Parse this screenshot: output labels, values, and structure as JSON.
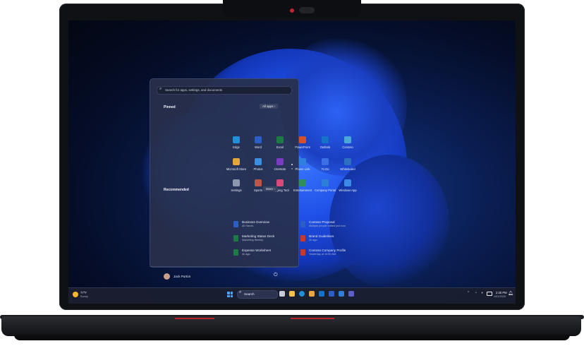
{
  "start_menu": {
    "search_placeholder": "Search for apps, settings, and documents",
    "pinned_label": "Pinned",
    "all_apps_label": "All apps",
    "pinned_apps": [
      {
        "label": "Edge",
        "icon": "edge-icon",
        "color": "#1f8fd8"
      },
      {
        "label": "Word",
        "icon": "word-icon",
        "color": "#2b5fc7"
      },
      {
        "label": "Excel",
        "icon": "excel-icon",
        "color": "#1d7a45"
      },
      {
        "label": "PowerPoint",
        "icon": "powerpoint-icon",
        "color": "#d2502a"
      },
      {
        "label": "Outlook",
        "icon": "outlook-icon",
        "color": "#1473c9"
      },
      {
        "label": "Contoso",
        "icon": "contoso-icon",
        "color": "#4aa7d9"
      },
      {
        "label": "Microsoft Store",
        "icon": "store-icon",
        "color": "#e8a53b"
      },
      {
        "label": "Photos",
        "icon": "photos-icon",
        "color": "#3a8fe0"
      },
      {
        "label": "OneNote",
        "icon": "onenote-icon",
        "color": "#7b3bbf"
      },
      {
        "label": "Phone Link",
        "icon": "phone-link-icon",
        "color": "#2f7fe0"
      },
      {
        "label": "To Do",
        "icon": "todo-icon",
        "color": "#3b6fe6"
      },
      {
        "label": "Whiteboard",
        "icon": "whiteboard-icon",
        "color": "#2c6fc2"
      },
      {
        "label": "Settings",
        "icon": "settings-icon",
        "color": "#8d98ad"
      },
      {
        "label": "Sports",
        "icon": "sports-icon",
        "color": "#b9584a"
      },
      {
        "label": "Snipping Tool",
        "icon": "snipping-tool-icon",
        "color": "#d94a7a"
      },
      {
        "label": "Entertainment",
        "icon": "entertainment-icon",
        "color": "#2f8f5a"
      },
      {
        "label": "Company Portal",
        "icon": "company-portal-icon",
        "color": "#2d7ed6"
      },
      {
        "label": "Windows App",
        "icon": "windows-app-icon",
        "color": "#3c8ae6"
      }
    ],
    "recommended_label": "Recommended",
    "more_label": "More",
    "recommended": [
      {
        "title": "Business Overview",
        "subtitle": "All Hands",
        "icon": "word-doc-icon",
        "color": "#2b5fc7"
      },
      {
        "title": "Contoso Proposal",
        "subtitle": "Multiple people edited just now",
        "icon": "word-doc-icon",
        "color": "#2b5fc7"
      },
      {
        "title": "Marketing Status Deck",
        "subtitle": "Marketing Weekly",
        "icon": "excel-doc-icon",
        "color": "#1d7a45"
      },
      {
        "title": "Brand Guidelines",
        "subtitle": "2h ago",
        "icon": "pdf-doc-icon",
        "color": "#c4382f"
      },
      {
        "title": "Expense Worksheet",
        "subtitle": "4h ago",
        "icon": "excel-doc-icon",
        "color": "#1d7a45"
      },
      {
        "title": "Contoso Company Profile",
        "subtitle": "Yesterday at 10:50 AM",
        "icon": "pdf-doc-icon",
        "color": "#c4382f"
      }
    ],
    "user_name": "Jack Purton"
  },
  "taskbar": {
    "weather_temp": "77°F",
    "weather_desc": "Sunny",
    "search_label": "Search",
    "time": "2:30 PM",
    "date": "1/01/2025"
  },
  "colors": {
    "accent": "#2f6bff",
    "laptop_red": "#b8252d"
  }
}
